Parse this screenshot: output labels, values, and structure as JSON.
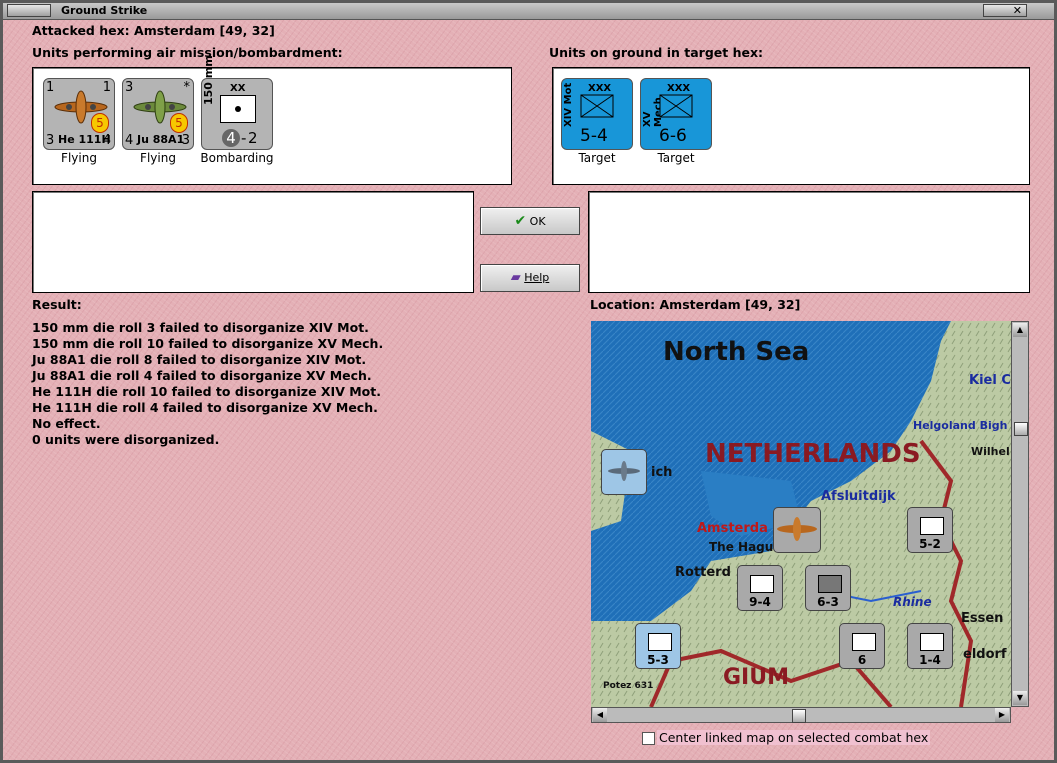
{
  "window": {
    "title": "Ground Strike"
  },
  "attacked_hex": "Attacked hex: Amsterdam  [49, 32]",
  "air_units_label": "Units performing air mission/bombardment:",
  "ground_units_label": "Units on ground in target hex:",
  "air_units": [
    {
      "name": "He 111H",
      "top_left": "1",
      "top_right": "1",
      "bottom_left": "3",
      "bottom_right": "4",
      "badge": "5",
      "status": "Flying"
    },
    {
      "name": "Ju 88A1",
      "top_left": "3",
      "top_right": "*",
      "bottom_left": "4",
      "bottom_right": "3",
      "badge": "5",
      "status": "Flying"
    },
    {
      "name": "150 mm",
      "size": "XX",
      "value_left": "4",
      "value_right": "2",
      "status": "Bombarding"
    }
  ],
  "ground_units": [
    {
      "name": "XIV Mot",
      "size": "XXX",
      "value": "5-4",
      "status": "Target"
    },
    {
      "name": "XV Mech",
      "size": "XXX",
      "value": "6-6",
      "status": "Target"
    }
  ],
  "buttons": {
    "ok": "OK",
    "help": "Help"
  },
  "result_label": "Result:",
  "results": [
    "150 mm die roll 3 failed to disorganize XIV Mot.",
    "150 mm die roll 10 failed to disorganize XV Mech.",
    "Ju 88A1 die roll 8 failed to disorganize XIV Mot.",
    "Ju 88A1 die roll 4 failed to disorganize XV Mech.",
    "He 111H die roll 10 failed to disorganize XIV Mot.",
    "He 111H die roll 4 failed to disorganize XV Mech.",
    "No effect.",
    "0 units were disorganized."
  ],
  "location_label": "Location:  Amsterdam  [49, 32]",
  "map": {
    "labels": {
      "north_sea": "North Sea",
      "netherlands": "NETHERLANDS",
      "kiel": "Kiel C",
      "helgoland": "Helgoland Bigh",
      "wilhel": "Wilhel",
      "afsluitdijk": "Afsluitdijk",
      "amsterdam": "Amsterda",
      "the_hague": "The Hagu",
      "rotterdam": "Rotterd",
      "rhine": "Rhine",
      "essen": "Essen",
      "dusseldorf": "eldorf",
      "belgium": "GIUM",
      "ich": "ich",
      "potez": "Potez 631"
    },
    "counters": [
      {
        "value": "5-2"
      },
      {
        "value": "9-4"
      },
      {
        "value": "6-3"
      },
      {
        "value": "5-3"
      },
      {
        "value": "1-4"
      },
      {
        "value": "6"
      }
    ]
  },
  "checkbox_label": "Center linked map on selected combat hex",
  "colors": {
    "dialog_bg": "#e4b0b6",
    "unit_blue": "#1896d8",
    "sea": "#1f6fb8",
    "land": "#b9c9a0",
    "border_red": "#a0282a"
  }
}
